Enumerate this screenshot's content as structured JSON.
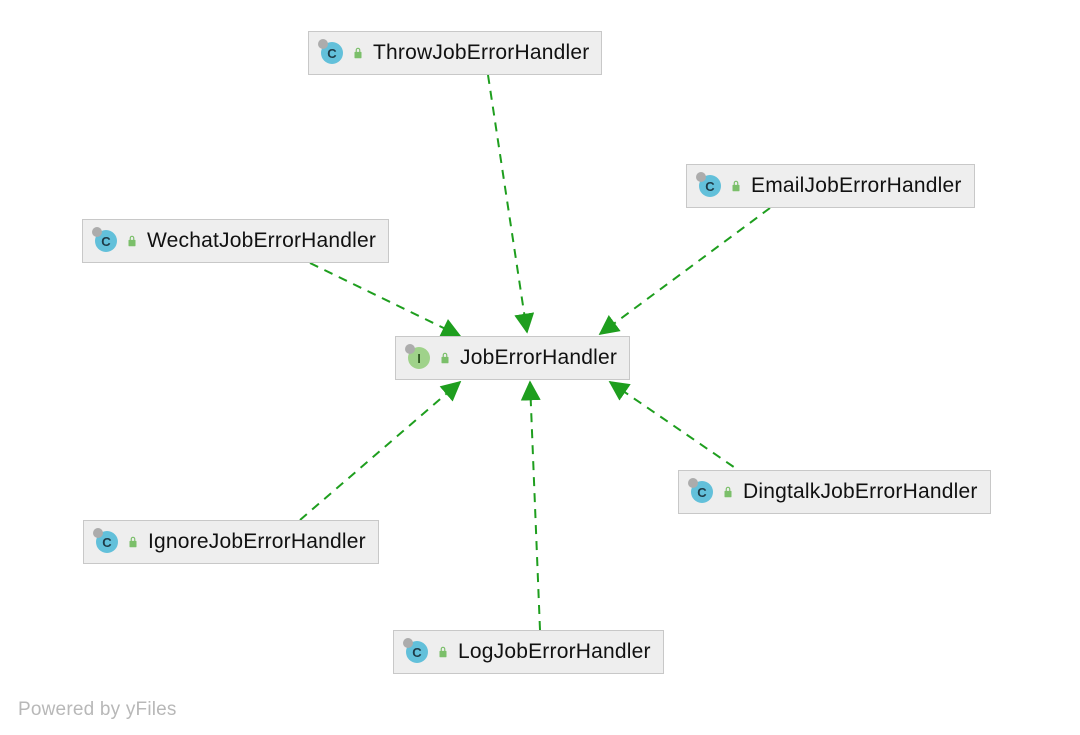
{
  "diagram": {
    "center": {
      "label": "JobErrorHandler",
      "kind": "I"
    },
    "nodes": {
      "throw": {
        "label": "ThrowJobErrorHandler",
        "kind": "C"
      },
      "email": {
        "label": "EmailJobErrorHandler",
        "kind": "C"
      },
      "wechat": {
        "label": "WechatJobErrorHandler",
        "kind": "C"
      },
      "dingtalk": {
        "label": "DingtalkJobErrorHandler",
        "kind": "C"
      },
      "ignore": {
        "label": "IgnoreJobErrorHandler",
        "kind": "C"
      },
      "log": {
        "label": "LogJobErrorHandler",
        "kind": "C"
      }
    }
  },
  "footer": "Powered by yFiles",
  "colors": {
    "edge": "#1e9e1e",
    "nodeFill": "#eeeeee",
    "nodeBorder": "#c8c8c8"
  }
}
